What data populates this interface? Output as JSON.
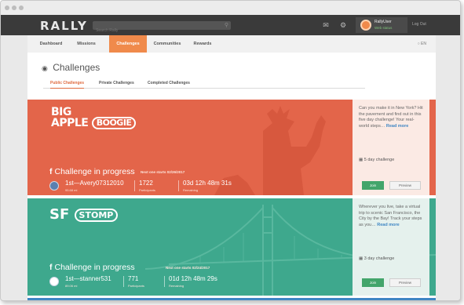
{
  "app": {
    "logo_main": "RALLY",
    "search_placeholder": "Search Rally",
    "user_name": "RallyUser",
    "user_status": "Web status",
    "logout": "Log Out",
    "lang": "EN"
  },
  "nav": [
    {
      "label": "Dashboard"
    },
    {
      "label": "Missions"
    },
    {
      "label": "Challenges"
    },
    {
      "label": "Communities"
    },
    {
      "label": "Rewards"
    }
  ],
  "page": {
    "title": "Challenges",
    "subtabs": [
      "Public Challenges",
      "Private Challenges",
      "Completed Challenges"
    ]
  },
  "challenges": [
    {
      "brand_line1": "BIG",
      "brand_line2": "APPLE",
      "brand_pill": "BOOGIE",
      "progress_title": "Challenge in progress",
      "next_race": "Next one starts 02/26/2017",
      "leader": "1st—Avery07312010",
      "leader_sub": "95.68 mi",
      "participants": "1722",
      "participants_label": "Participants",
      "remaining": "03d 12h 48m 31s",
      "remaining_label": "Remaining",
      "card_text": "Can you make it in New York? Hit the pavement and find out in this five day challenge! Your real-world steps…",
      "read_more": "Read more",
      "duration": "5 day challenge",
      "join": "Join",
      "preview": "Preview",
      "color": "#e3654a"
    },
    {
      "brand_line1": "SF",
      "brand_pill": "STOMP",
      "progress_title": "Challenge in progress",
      "next_race": "Next one starts 02/24/2017",
      "leader": "1st—stanner531",
      "leader_sub": "89.06 mi",
      "participants": "771",
      "participants_label": "Participants",
      "remaining": "01d 12h 48m 29s",
      "remaining_label": "Remaining",
      "card_text": "Wherever you live, take a virtual trip to scenic San Francisco, the City by the Bay! Track your steps as you…",
      "read_more": "Read more",
      "duration": "3 day challenge",
      "join": "Join",
      "preview": "Preview",
      "color": "#3ea88d"
    }
  ]
}
